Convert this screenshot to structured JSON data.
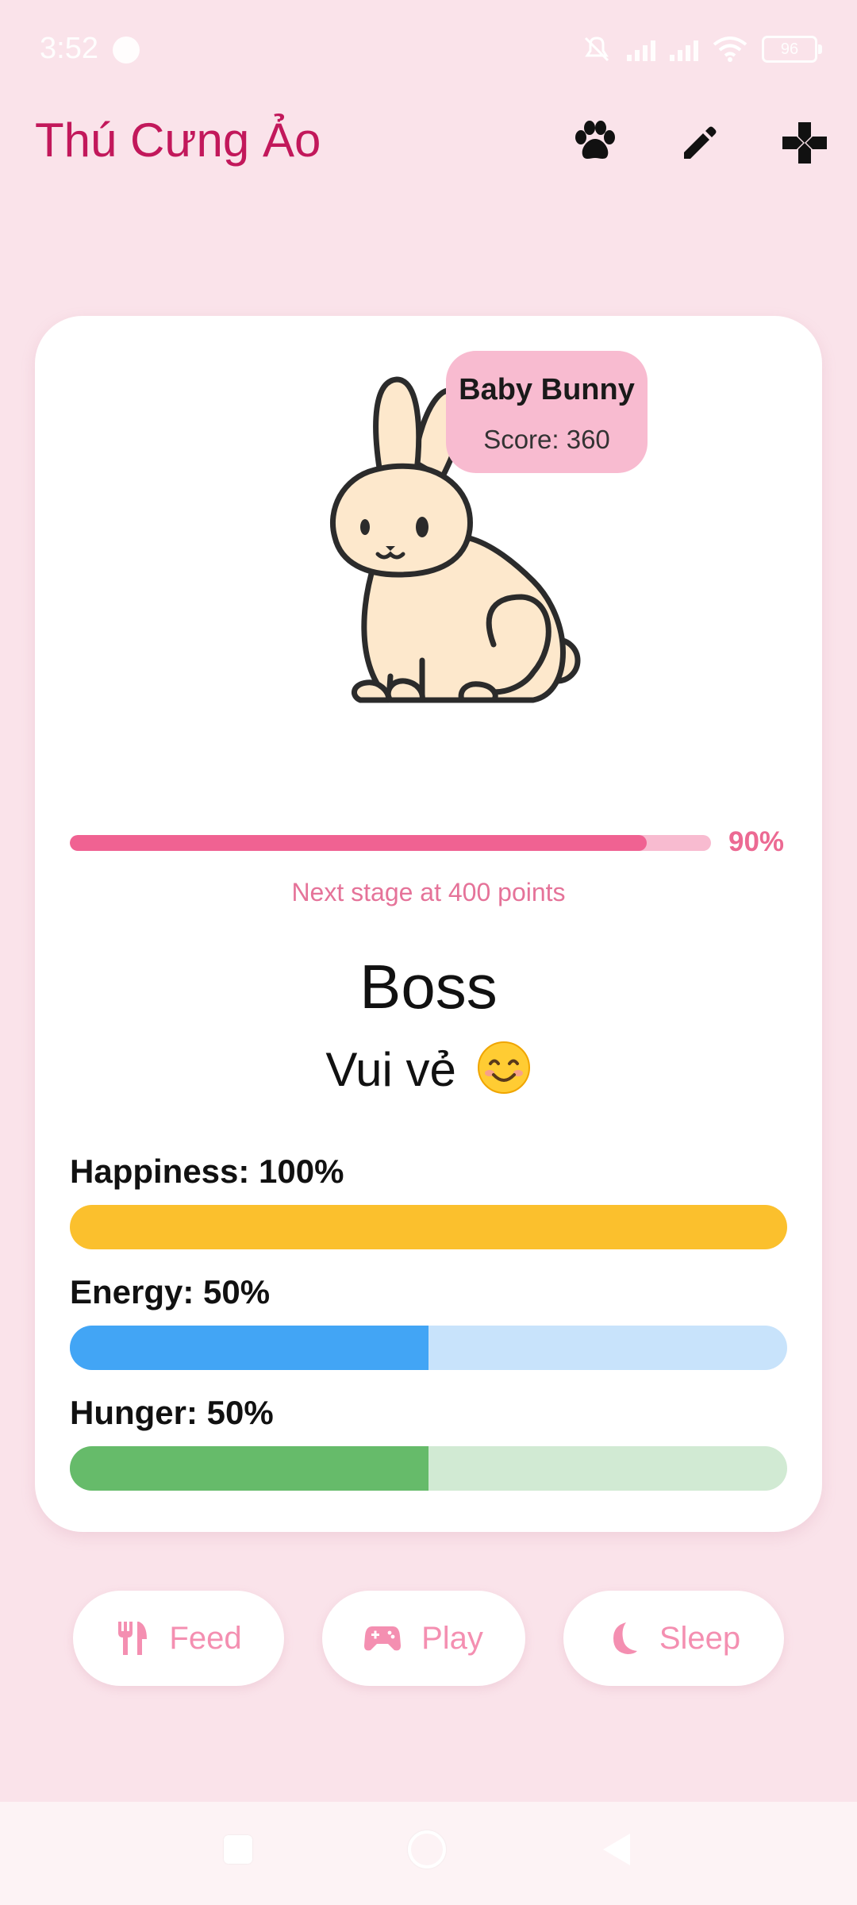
{
  "status_bar": {
    "time": "3:52",
    "battery": "96"
  },
  "app_bar": {
    "title": "Thú Cưng Ảo",
    "icons": [
      "paw-icon",
      "pencil-icon",
      "gamepad-icon"
    ]
  },
  "pet": {
    "stage_name": "Baby Bunny",
    "score_text": "Score: 360",
    "progress_percent": 90,
    "progress_label": "90%",
    "next_stage_text": "Next stage at 400 points",
    "name": "Boss",
    "mood": "Vui vẻ",
    "mood_emoji": "smiling-face-emoji"
  },
  "stats": [
    {
      "label": "Happiness: 100%",
      "value": 100,
      "fill_color": "#fbc02d",
      "track_color": "#fbc02d"
    },
    {
      "label": "Energy: 50%",
      "value": 50,
      "fill_color": "#42a5f5",
      "track_color": "#c8e3fb"
    },
    {
      "label": "Hunger: 50%",
      "value": 50,
      "fill_color": "#66bb6a",
      "track_color": "#d1ead3"
    }
  ],
  "actions": {
    "feed": {
      "label": "Feed",
      "icon": "fork-knife-icon"
    },
    "play": {
      "label": "Play",
      "icon": "gamepad-icon"
    },
    "sleep": {
      "label": "Sleep",
      "icon": "moon-icon"
    }
  },
  "colors": {
    "background": "#fae3ea",
    "accent": "#c2185b",
    "progress": "#f06292",
    "action_text": "#f48fb1"
  }
}
